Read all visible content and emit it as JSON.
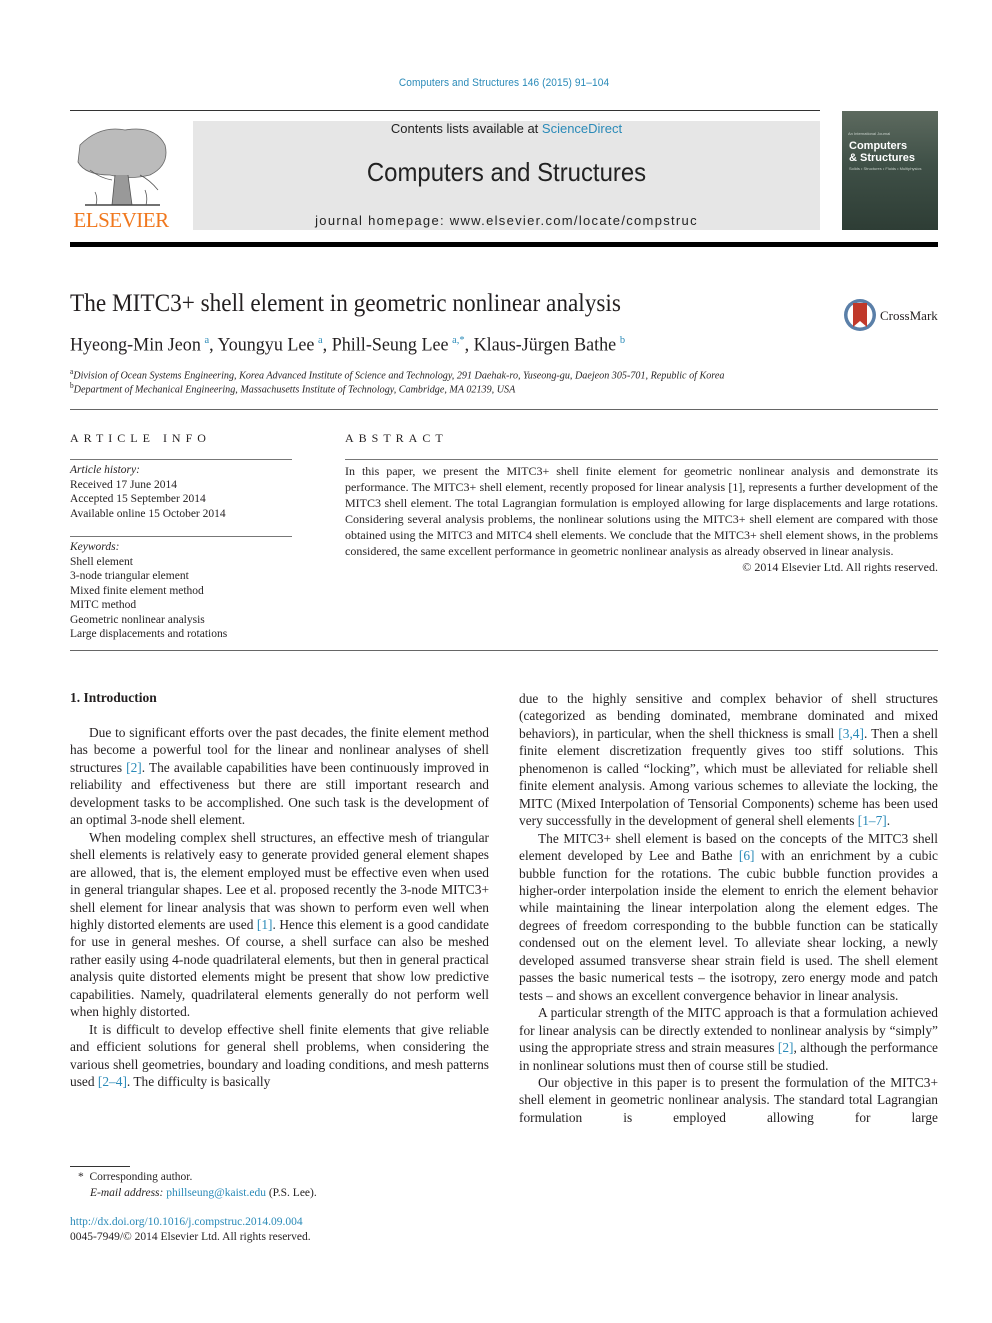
{
  "header": {
    "citation": "Computers and Structures 146 (2015) 91–104",
    "publisher_logo_text": "ELSEVIER",
    "contents_prefix": "Contents lists available at ",
    "contents_link": "ScienceDirect",
    "journal_title": "Computers and Structures",
    "homepage": "journal homepage: www.elsevier.com/locate/compstruc",
    "cover": {
      "small_text": "An International Journal",
      "title_line1": "Computers",
      "title_line2": "& Structures",
      "subtitle": "Solids • Structures • Fluids • Multiphysics"
    }
  },
  "article": {
    "title": "The MITC3+ shell element in geometric nonlinear analysis",
    "crossmark_label": "CrossMark",
    "authors": [
      {
        "name": "Hyeong-Min Jeon",
        "sup": "a"
      },
      {
        "name": "Youngyu Lee",
        "sup": "a"
      },
      {
        "name": "Phill-Seung Lee",
        "sup": "a,*"
      },
      {
        "name": "Klaus-Jürgen Bathe",
        "sup": "b"
      }
    ],
    "affiliations": [
      {
        "sup": "a",
        "text": "Division of Ocean Systems Engineering, Korea Advanced Institute of Science and Technology, 291 Daehak-ro, Yuseong-gu, Daejeon 305-701, Republic of Korea"
      },
      {
        "sup": "b",
        "text": "Department of Mechanical Engineering, Massachusetts Institute of Technology, Cambridge, MA 02139, USA"
      }
    ]
  },
  "article_info": {
    "heading": "ARTICLE INFO",
    "history_label": "Article history:",
    "history": [
      "Received 17 June 2014",
      "Accepted 15 September 2014",
      "Available online 15 October 2014"
    ],
    "keywords_label": "Keywords:",
    "keywords": [
      "Shell element",
      "3-node triangular element",
      "Mixed finite element method",
      "MITC method",
      "Geometric nonlinear analysis",
      "Large displacements and rotations"
    ]
  },
  "abstract": {
    "heading": "ABSTRACT",
    "text": "In this paper, we present the MITC3+ shell finite element for geometric nonlinear analysis and demonstrate its performance. The MITC3+ shell element, recently proposed for linear analysis [1], represents a further development of the MITC3 shell element. The total Lagrangian formulation is employed allowing for large displacements and large rotations. Considering several analysis problems, the nonlinear solutions using the MITC3+ shell element are compared with those obtained using the MITC3 and MITC4 shell elements. We conclude that the MITC3+ shell element shows, in the problems considered, the same excellent performance in geometric nonlinear analysis as already observed in linear analysis.",
    "copyright": "© 2014 Elsevier Ltd. All rights reserved."
  },
  "body": {
    "section_heading": "1. Introduction",
    "left_paragraphs": [
      {
        "before": "Due to significant efforts over the past decades, the finite element method has become a powerful tool for the linear and nonlinear analyses of shell structures ",
        "ref": "[2]",
        "after": ". The available capabilities have been continuously improved in reliability and effectiveness but there are still important research and development tasks to be accomplished. One such task is the development of an optimal 3-node shell element."
      },
      {
        "before": "When modeling complex shell structures, an effective mesh of triangular shell elements is relatively easy to generate provided general element shapes are allowed, that is, the element employed must be effective even when used in general triangular shapes. Lee et al. proposed recently the 3-node MITC3+ shell element for linear analysis that was shown to perform even well when highly distorted elements are used ",
        "ref": "[1]",
        "after": ". Hence this element is a good candidate for use in general meshes. Of course, a shell surface can also be meshed rather easily using 4-node quadrilateral elements, but then in general practical analysis quite distorted elements might be present that show low predictive capabilities. Namely, quadrilateral elements generally do not perform well when highly distorted."
      },
      {
        "before": "It is difficult to develop effective shell finite elements that give reliable and efficient solutions for general shell problems, when considering the various shell geometries, boundary and loading conditions, and mesh patterns used ",
        "ref": "[2–4]",
        "after": ". The difficulty is basically"
      }
    ],
    "right_paragraphs": [
      {
        "before": "due to the highly sensitive and complex behavior of shell structures (categorized as bending dominated, membrane dominated and mixed behaviors), in particular, when the shell thickness is small ",
        "ref": "[3,4]",
        "after": ". Then a shell finite element discretization frequently gives too stiff solutions. This phenomenon is called “locking”, which must be alleviated for reliable shell finite element analysis. Among various schemes to alleviate the locking, the MITC (Mixed Interpolation of Tensorial Components) scheme has been used very successfully in the development of general shell elements ",
        "ref2": "[1–7]",
        "after2": "."
      },
      {
        "before": "The MITC3+ shell element is based on the concepts of the MITC3 shell element developed by Lee and Bathe ",
        "ref": "[6]",
        "after": " with an enrichment by a cubic bubble function for the rotations. The cubic bubble function provides a higher-order interpolation inside the element to enrich the element behavior while maintaining the linear interpolation along the element edges. The degrees of freedom corresponding to the bubble function can be statically condensed out on the element level. To alleviate shear locking, a newly developed assumed transverse shear strain field is used. The shell element passes the basic numerical tests – the isotropy, zero energy mode and patch tests – and shows an excellent convergence behavior in linear analysis."
      },
      {
        "before": "A particular strength of the MITC approach is that a formulation achieved for linear analysis can be directly extended to nonlinear analysis by “simply” using the appropriate stress and strain measures ",
        "ref": "[2]",
        "after": ", although the performance in nonlinear solutions must then of course still be studied."
      },
      {
        "before": "Our objective in this paper is to present the formulation of the MITC3+ shell element in geometric nonlinear analysis. The standard total Lagrangian formulation is employed allowing for large",
        "ref": "",
        "after": ""
      }
    ]
  },
  "footnotes": {
    "corresponding_mark": "*",
    "corresponding_text": "Corresponding author.",
    "email_label": "E-mail address: ",
    "email": "phillseung@kaist.edu",
    "email_suffix": " (P.S. Lee).",
    "doi": "http://dx.doi.org/10.1016/j.compstruc.2014.09.004",
    "issn_line": "0045-7949/© 2014 Elsevier Ltd. All rights reserved."
  },
  "colors": {
    "link": "#2a8ab8",
    "elsevier_orange": "#f0781e",
    "banner_gray": "#e6e6e6",
    "crossmark_red": "#c0392b"
  }
}
